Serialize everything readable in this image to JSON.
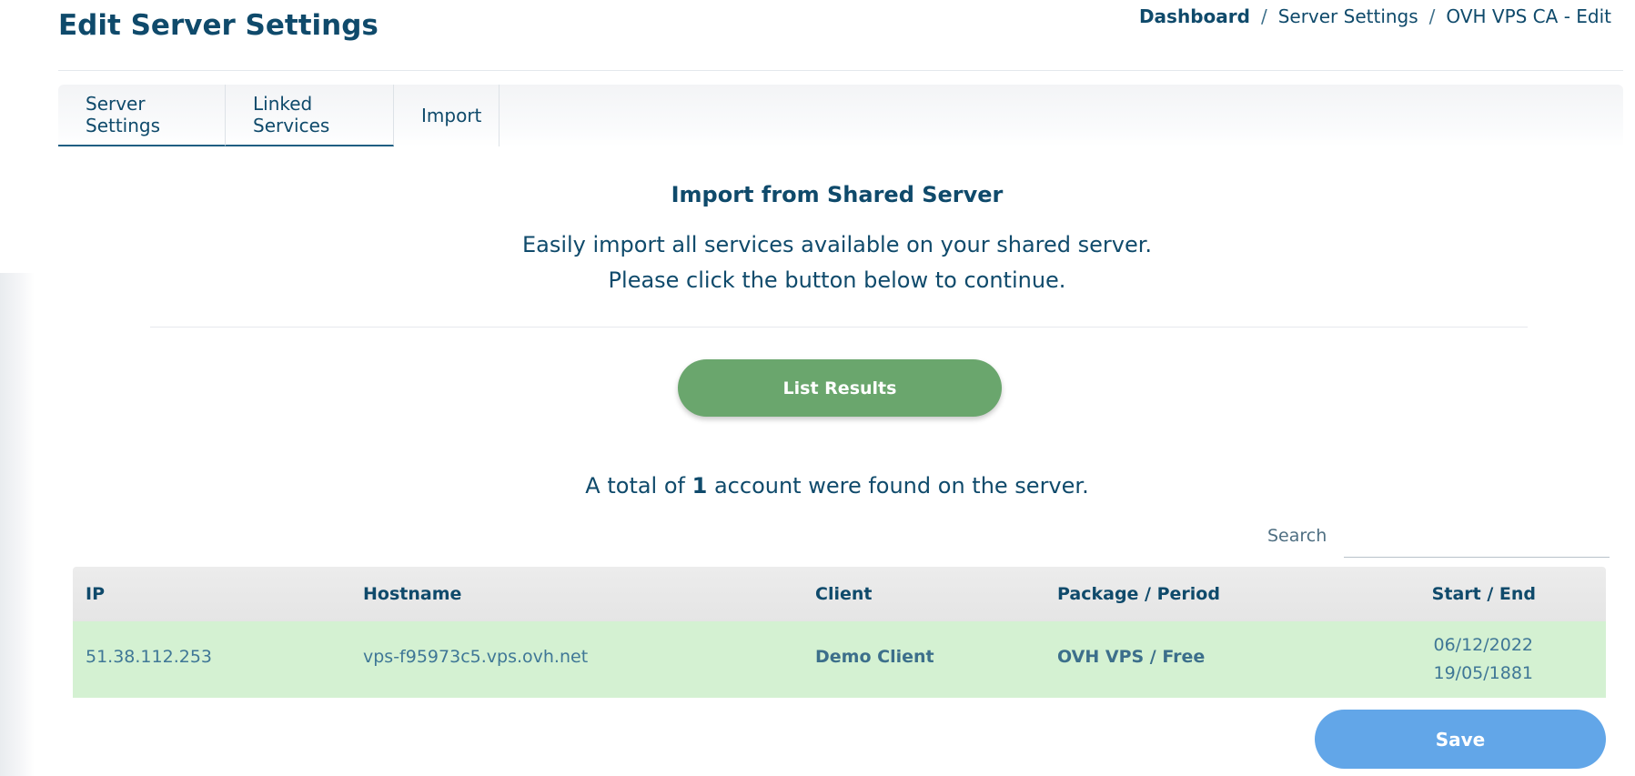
{
  "header": {
    "title": "Edit Server Settings",
    "breadcrumb": [
      "Dashboard",
      "Server Settings",
      "OVH VPS CA - Edit"
    ]
  },
  "tabs": [
    {
      "label": "Server Settings"
    },
    {
      "label": "Linked Services"
    },
    {
      "label": "Import"
    }
  ],
  "import": {
    "title": "Import from Shared Server",
    "description_line1": "Easily import all services available on your shared server.",
    "description_line2": "Please click the button below to continue.",
    "list_button_label": "List Results",
    "total_prefix": "A total of",
    "total_count": "1",
    "total_suffix": "account were found on the server."
  },
  "search": {
    "label": "Search",
    "value": ""
  },
  "table": {
    "columns": [
      "IP",
      "Hostname",
      "Client",
      "Package / Period",
      "Start / End"
    ],
    "rows": [
      {
        "ip": "51.38.112.253",
        "hostname": "vps-f95973c5.vps.ovh.net",
        "client": "Demo Client",
        "package": "OVH VPS / Free",
        "start": "06/12/2022",
        "end": "19/05/1881"
      }
    ]
  },
  "actions": {
    "save_label": "Save"
  },
  "colors": {
    "primary_text": "#0f4a6b",
    "list_button": "#6aa66d",
    "save_button": "#62a6e8",
    "row_highlight": "#d4f1d2"
  }
}
